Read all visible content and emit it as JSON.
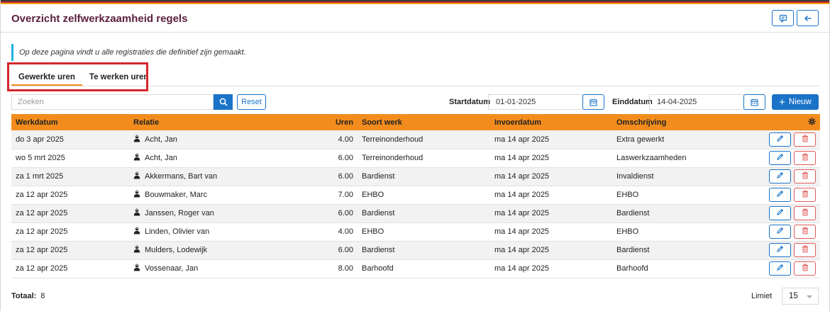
{
  "header": {
    "title": "Overzicht zelfwerkzaamheid regels"
  },
  "info": {
    "text": "Op deze pagina vindt u alle registraties die definitief zijn gemaakt."
  },
  "tabs": [
    {
      "label": "Gewerkte uren",
      "active": true
    },
    {
      "label": "Te werken uren",
      "active": false
    }
  ],
  "toolbar": {
    "search_placeholder": "Zoeken",
    "reset_label": "Reset",
    "start_label": "Startdatum",
    "start_value": "01-01-2025",
    "end_label": "Einddatum",
    "end_value": "14-04-2025",
    "new_label": "Nieuw"
  },
  "table": {
    "columns": [
      "Werkdatum",
      "Relatie",
      "Uren",
      "Soort werk",
      "Invoerdatum",
      "Omschrijving"
    ],
    "rows": [
      {
        "werkdatum": "do 3 apr 2025",
        "relatie": "Acht, Jan",
        "uren": "4.00",
        "soort": "Terreinonderhoud",
        "invoer": "ma 14 apr 2025",
        "omschrijving": "Extra gewerkt"
      },
      {
        "werkdatum": "wo 5 mrt 2025",
        "relatie": "Acht, Jan",
        "uren": "6.00",
        "soort": "Terreinonderhoud",
        "invoer": "ma 14 apr 2025",
        "omschrijving": "Laswerkzaamheden"
      },
      {
        "werkdatum": "za 1 mrt 2025",
        "relatie": "Akkermans, Bart van",
        "uren": "6.00",
        "soort": "Bardienst",
        "invoer": "ma 14 apr 2025",
        "omschrijving": "Invaldienst"
      },
      {
        "werkdatum": "za 12 apr 2025",
        "relatie": "Bouwmaker, Marc",
        "uren": "7.00",
        "soort": "EHBO",
        "invoer": "ma 14 apr 2025",
        "omschrijving": "EHBO"
      },
      {
        "werkdatum": "za 12 apr 2025",
        "relatie": "Janssen, Roger van",
        "uren": "6.00",
        "soort": "Bardienst",
        "invoer": "ma 14 apr 2025",
        "omschrijving": "Bardienst"
      },
      {
        "werkdatum": "za 12 apr 2025",
        "relatie": "Linden, Olivier van",
        "uren": "4.00",
        "soort": "EHBO",
        "invoer": "ma 14 apr 2025",
        "omschrijving": "EHBO"
      },
      {
        "werkdatum": "za 12 apr 2025",
        "relatie": "Mulders, Lodewijk",
        "uren": "6.00",
        "soort": "Bardienst",
        "invoer": "ma 14 apr 2025",
        "omschrijving": "Bardienst"
      },
      {
        "werkdatum": "za 12 apr 2025",
        "relatie": "Vossenaar, Jan",
        "uren": "8.00",
        "soort": "Barhoofd",
        "invoer": "ma 14 apr 2025",
        "omschrijving": "Barhoofd"
      }
    ]
  },
  "footer": {
    "totaal_label": "Totaal:",
    "totaal_value": "8",
    "limiet_label": "Limiet",
    "limiet_value": "15"
  },
  "colors": {
    "accent": "#1a73c8",
    "header_row": "#f28c1d",
    "title": "#5a1f3e",
    "highlight": "#d7262d",
    "danger": "#e05a5a"
  }
}
